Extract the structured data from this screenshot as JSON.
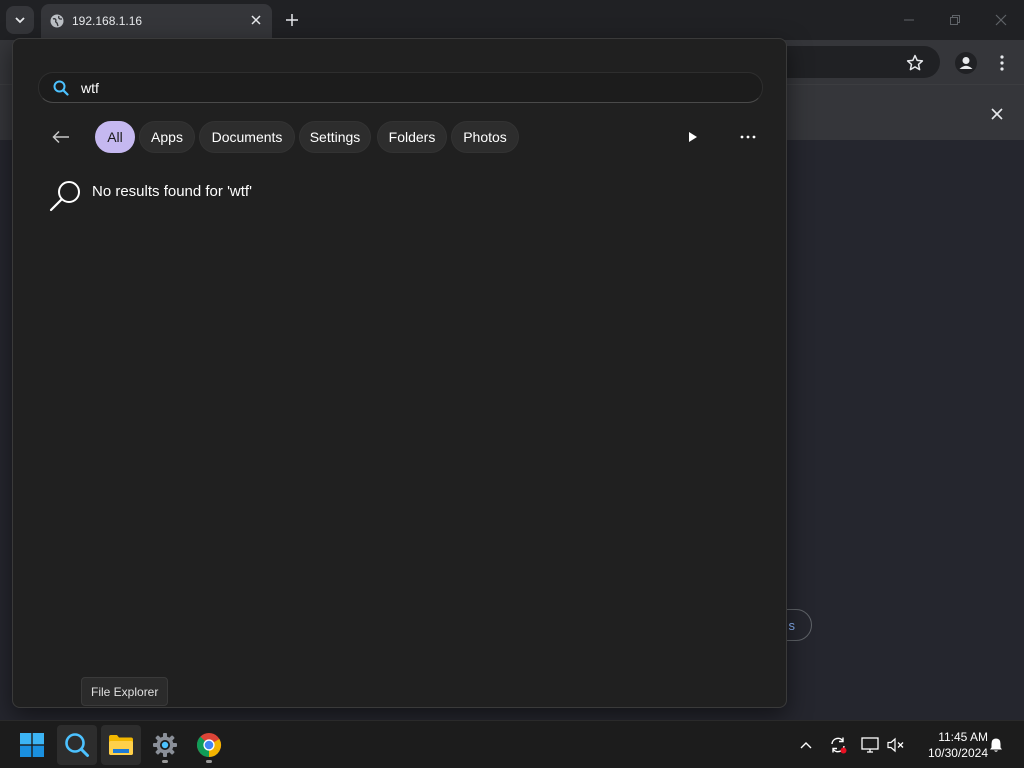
{
  "browser": {
    "tab_title": "192.168.1.16",
    "page_button_label": "s"
  },
  "search": {
    "query": "wtf",
    "filters": [
      "All",
      "Apps",
      "Documents",
      "Settings",
      "Folders",
      "Photos"
    ],
    "active_filter": "All",
    "no_results_message": "No results found for 'wtf'"
  },
  "tooltip": {
    "text": "File Explorer"
  },
  "taskbar": {
    "time": "11:45 AM",
    "date": "10/30/2024",
    "apps": [
      "start-icon",
      "search-icon",
      "file-explorer-icon",
      "settings-icon",
      "chrome-icon"
    ]
  },
  "colors": {
    "active_chip": "#c5b8f0",
    "panel_bg": "#202020",
    "chrome_frame": "#202124"
  }
}
